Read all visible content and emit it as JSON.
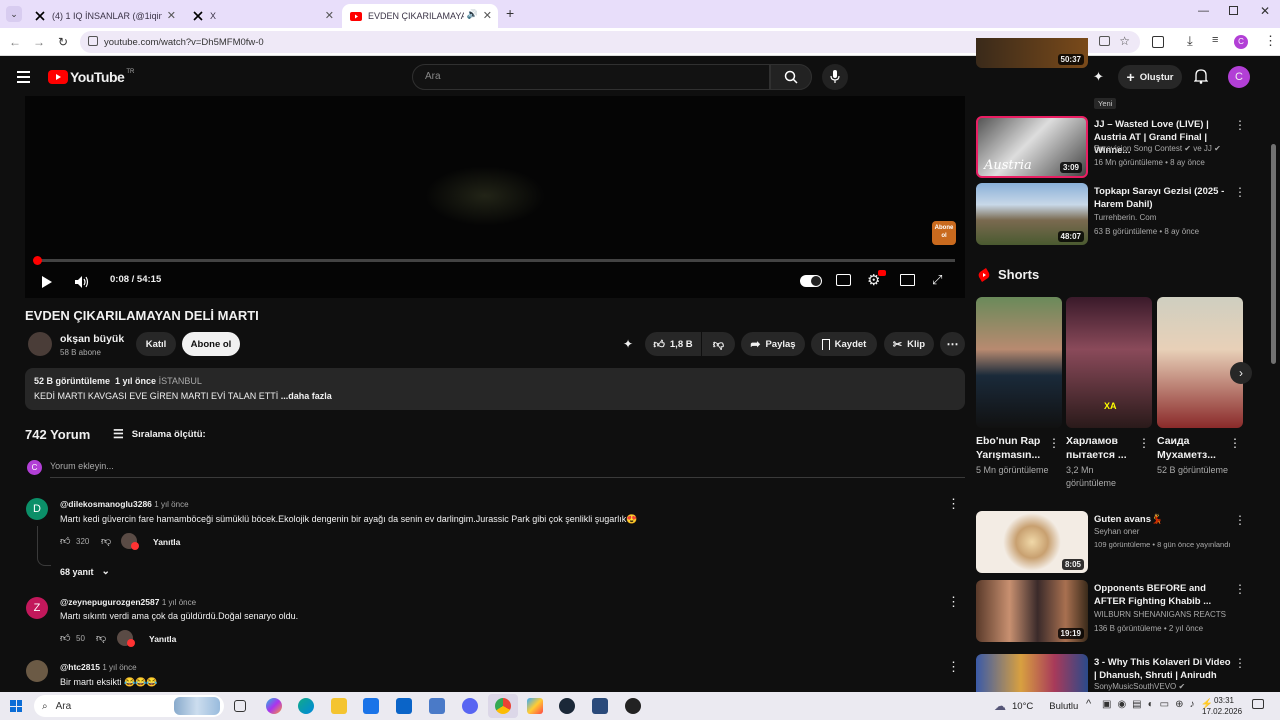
{
  "browser": {
    "tabs": [
      {
        "label": "(4) 1 IQ İNSANLAR (@1iqinsanla",
        "icon": "x-logo-icon"
      },
      {
        "label": "X",
        "icon": "x-logo-icon"
      },
      {
        "label": "EVDEN ÇIKARILAMAYAN D",
        "icon": "youtube-icon"
      }
    ],
    "new_tab": "+",
    "url": "youtube.com/watch?v=Dh5MFM0fw-0",
    "profile_initial": "C"
  },
  "youtube": {
    "logo_text": "YouTube",
    "region": "TR",
    "search_placeholder": "Ara",
    "create_label": "Oluştur",
    "avatar_initial": "C",
    "colors": {
      "accent": "#ff0000",
      "avatar": "#b23fd6",
      "short_border": "#e91e63"
    }
  },
  "player": {
    "time": "0:08 / 54:15",
    "watermark": "Abone ol",
    "progress_fraction": 0.0025
  },
  "video": {
    "title": "EVDEN ÇIKARILAMAYAN DELİ MARTI",
    "channel": "okşan büyük",
    "subs": "58 B abone",
    "join": "Katıl",
    "subscribe": "Abone ol",
    "likes": "1,8 B",
    "share": "Paylaş",
    "save": "Kaydet",
    "clip": "Klip",
    "desc_stats": "52 B görüntüleme  1 yıl önce",
    "desc_location": "İSTANBUL",
    "desc_text": "KEDİ MARTI KAVGASI EVE GİREN MARTI EVİ TALAN ETTİ",
    "desc_more": "...daha fazla"
  },
  "comments": {
    "count": "742 Yorum",
    "sort": "Sıralama ölçütü:",
    "add_placeholder": "Yorum ekleyin...",
    "add_avatar": "C",
    "reply_label": "Yanıtla",
    "items": [
      {
        "author": "@dilekosmanoglu3286",
        "time": "1 yıl önce",
        "text": "Martı  kedi güvercin fare hamamböceği sümüklü böcek.Ekolojik dengenin bir ayağı da senin ev darlingim.Jurassic Park gibi çok şenlikli şugarlık😍",
        "likes": "320",
        "avatar": "D",
        "replies": "68 yanıt"
      },
      {
        "author": "@zeynepugurozgen2587",
        "time": "1 yıl önce",
        "text": "Martı sıkıntı verdi ama çok da güldürdü.Doğal senaryo oldu.",
        "likes": "50",
        "avatar": "Z"
      },
      {
        "author": "@htc2815",
        "time": "1 yıl önce",
        "text": "Bir martı eksikti 😂😂😂",
        "likes": "",
        "avatar": ""
      }
    ]
  },
  "sidebar": {
    "top_badge": "Yeni",
    "top_duration": "50:37",
    "videos": [
      {
        "title": "JJ – Wasted Love (LIVE) | Austria AT | Grand Final | Winne...",
        "channel": "Eurovision Song Contest",
        "channel_suffix": "ve JJ",
        "meta": "16 Mn görüntüleme • 8 ay önce",
        "duration": "3:09",
        "thumb_text": "Austria"
      },
      {
        "title": "Topkapı Sarayı Gezisi (2025 - Harem Dahil)",
        "channel": "Turrehberin. Com",
        "meta": "63 B görüntüleme • 8 ay önce",
        "duration": "48:07"
      }
    ],
    "shorts_label": "Shorts",
    "shorts": [
      {
        "title": "Ebo'nun Rap Yarışmasın...",
        "views": "5 Mn görüntüleme"
      },
      {
        "title": "Харламов пытается ...",
        "views": "3,2 Mn görüntüleme",
        "thumb_text": "XA"
      },
      {
        "title": "Саида Мухаметз...",
        "views": "52 B görüntüleme"
      }
    ],
    "videos2": [
      {
        "title": "Guten avans💃",
        "channel": "Seyhan oner",
        "meta": "109 görüntüleme • 8 gün önce yayınlandı",
        "duration": "8:05"
      },
      {
        "title": "Opponents BEFORE and AFTER Fighting Khabib ...",
        "channel": "WILBURN SHENANIGANS REACTS",
        "meta": "136 B görüntüleme • 2 yıl önce",
        "duration": "19:19"
      },
      {
        "title": "3 - Why This Kolaveri Di Video | Dhanush, Shruti | Anirudh",
        "channel": "SonyMusicSouthVEVO",
        "meta": "",
        "duration": ""
      }
    ]
  },
  "taskbar": {
    "search": "Ara",
    "weather": "10°C",
    "weather_desc": "Bulutlu",
    "time": "03:31",
    "date": "17.02.2026"
  }
}
